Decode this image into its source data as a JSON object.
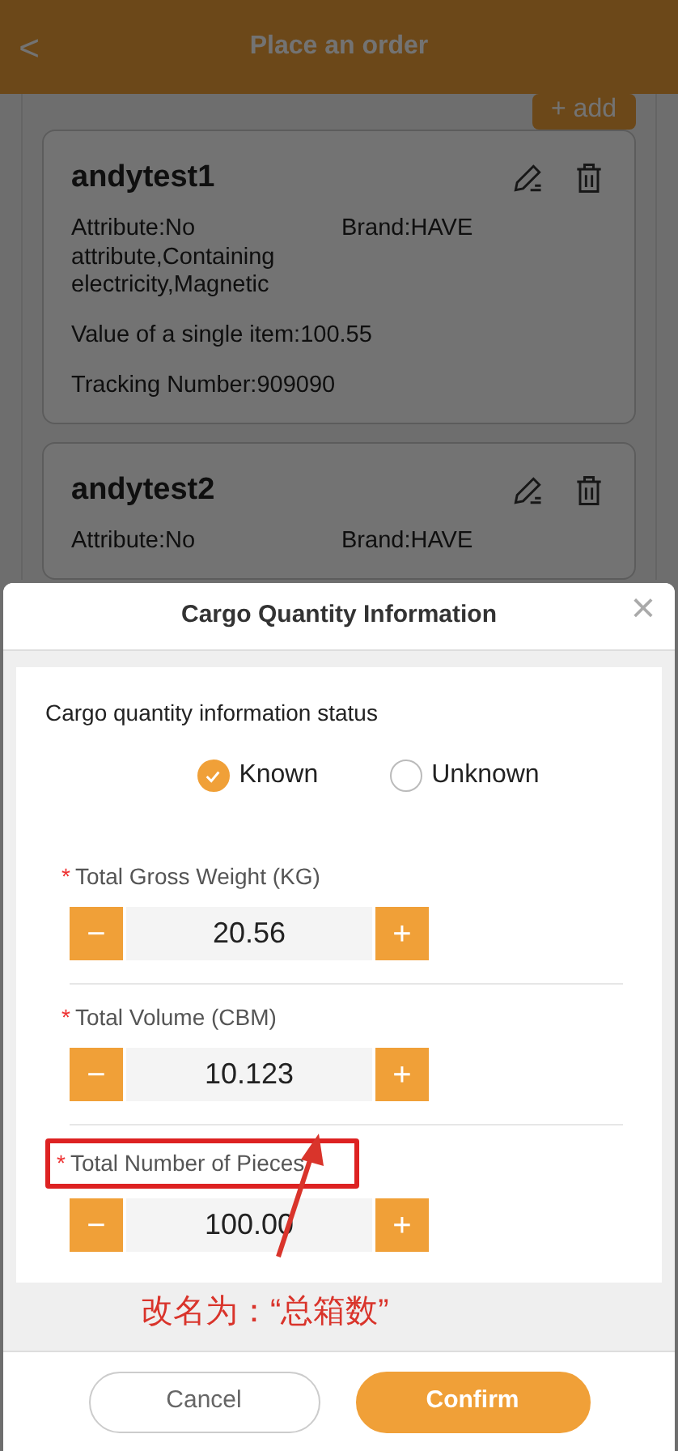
{
  "header": {
    "back": "<",
    "title": "Place an order"
  },
  "add_button": "+ add",
  "cards": [
    {
      "name": "andytest1",
      "fields": [
        {
          "kind": "pair",
          "left": "Attribute:No attribute,Containing electricity,Magnetic",
          "right": "Brand:HAVE"
        },
        {
          "kind": "single",
          "text": "Value of a single item:100.55"
        },
        {
          "kind": "single",
          "text": "Tracking Number:909090"
        }
      ]
    },
    {
      "name": "andytest2",
      "fields": [
        {
          "kind": "pair",
          "left": "Attribute:No",
          "right": "Brand:HAVE"
        }
      ]
    }
  ],
  "dialog": {
    "title": "Cargo Quantity Information",
    "close": "×",
    "status_label": "Cargo quantity information status",
    "options": [
      {
        "label": "Known",
        "selected": true
      },
      {
        "label": "Unknown",
        "selected": false
      }
    ],
    "steppers": [
      {
        "label": "Total Gross Weight (KG)",
        "required_mark": "*",
        "value": "20.56",
        "minus": "−",
        "plus": "+",
        "highlighted": false
      },
      {
        "label": "Total Volume (CBM)",
        "required_mark": "*",
        "value": "10.123",
        "minus": "−",
        "plus": "+",
        "highlighted": false
      },
      {
        "label": "Total Number of Pieces",
        "required_mark": "*",
        "value": "100.00",
        "minus": "−",
        "plus": "+",
        "highlighted": true
      }
    ],
    "annotation": "改名为：“总箱数”",
    "buttons": [
      {
        "kind": "secondary",
        "label": "Cancel"
      },
      {
        "kind": "primary",
        "label": "Confirm"
      }
    ]
  }
}
